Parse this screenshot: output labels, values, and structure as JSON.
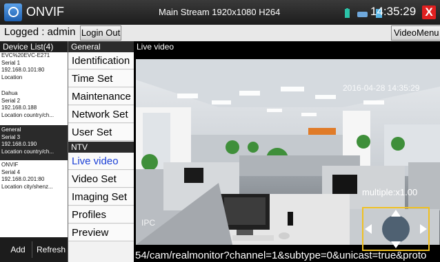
{
  "topbar": {
    "title": "ONVIF",
    "stream_info": "Main Stream 1920x1080 H264",
    "clock": "14:35:29",
    "close_label": "X"
  },
  "loginbar": {
    "logged_label": "Logged : admin",
    "login_out": "Login Out",
    "video_menu": "VideoMenu"
  },
  "devices": {
    "header": "Device List(4)",
    "items": [
      {
        "name": "EVC%20EVC-E271",
        "serial": "Serial 1",
        "ip": "192.168.0.101:80",
        "location": "Location"
      },
      {
        "name": "Dahua",
        "serial": "Serial 2",
        "ip": "192.168.0.188",
        "location": "Location country/ch..."
      },
      {
        "name": "General",
        "serial": "Serial 3",
        "ip": "192.168.0.190",
        "location": "Location country/ch..."
      },
      {
        "name": "ONVIF",
        "serial": "Serial 4",
        "ip": "192.168.0.201:80",
        "location": "Location city/shenz..."
      }
    ],
    "add": "Add",
    "refresh": "Refresh"
  },
  "menu": {
    "general_head": "General",
    "ntv_head": "NTV",
    "general": [
      "Identification",
      "Time Set",
      "Maintenance",
      "Network Set",
      "User Set"
    ],
    "ntv": [
      "Live video",
      "Video Set",
      "Imaging Set",
      "Profiles",
      "Preview"
    ]
  },
  "video": {
    "label": "Live video",
    "osd_time": "2016-04-28 14:35:29",
    "osd_cam": "IPC",
    "zoom": "multiple:x1.00",
    "rtsp_url": "54/cam/realmonitor?channel=1&subtype=0&unicast=true&proto"
  }
}
